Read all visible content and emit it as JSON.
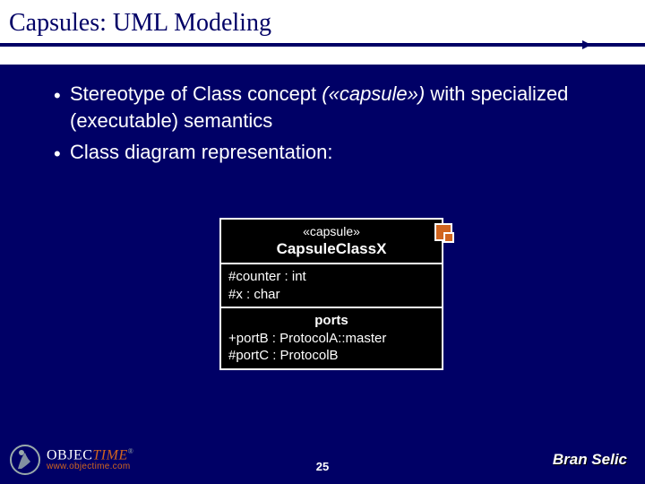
{
  "title": "Capsules: UML Modeling",
  "bullets": [
    {
      "pre": "Stereotype of Class concept ",
      "em": "(«capsule») ",
      "post": "with specialized (executable) semantics"
    },
    {
      "pre": "Class diagram representation:",
      "em": "",
      "post": ""
    }
  ],
  "uml": {
    "stereotype": "«capsule»",
    "class_name": "CapsuleClassX",
    "attributes": [
      "#counter : int",
      "#x : char"
    ],
    "ports_label": "ports",
    "ports": [
      "+portB : ProtocolA::master",
      "#portC : ProtocolB"
    ]
  },
  "footer": {
    "brand_obj": "OBJEC",
    "brand_time": "TIME",
    "reg": "®",
    "url": "www.objectime.com",
    "page": "25",
    "author": "Bran Selic"
  }
}
